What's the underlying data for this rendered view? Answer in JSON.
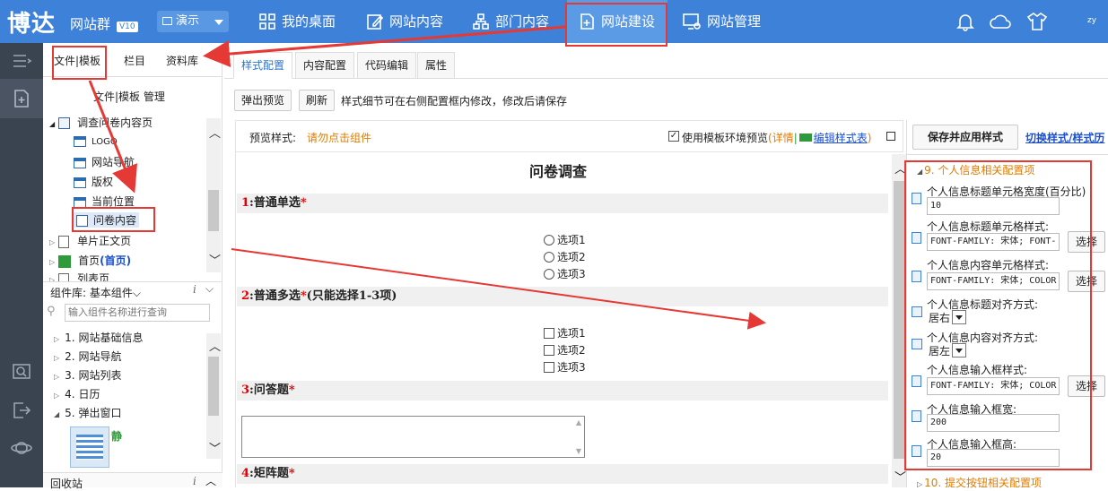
{
  "app": {
    "logo": "博达",
    "logo_sub": "网站群",
    "version": "V10",
    "demo": "演示"
  },
  "nav": [
    {
      "label": "我的桌面"
    },
    {
      "label": "网站内容"
    },
    {
      "label": "部门内容"
    },
    {
      "label": "网站建设"
    },
    {
      "label": "网站管理"
    }
  ],
  "user_short": "zy",
  "left": {
    "tabs": [
      "文件|模板",
      "栏目",
      "资料库"
    ],
    "title": "文件|模板 管理",
    "tree": {
      "root": "调查问卷内容页",
      "children": [
        "LOGO",
        "网站导航",
        "版权",
        "当前位置",
        "问卷内容"
      ],
      "siblings": [
        "单片正文页",
        "首页",
        "(首页)",
        "列表页"
      ]
    },
    "component_lib": "组件库: 基本组件",
    "search_placeholder": "输入组件名称进行查询",
    "components": [
      {
        "num": "1.",
        "label": "网站基础信息"
      },
      {
        "num": "2.",
        "label": "网站导航"
      },
      {
        "num": "3.",
        "label": "网站列表"
      },
      {
        "num": "4.",
        "label": "日历"
      },
      {
        "num": "5.",
        "label": "弹出窗口"
      }
    ],
    "thumb_label": "静",
    "recycle": "回收站"
  },
  "main": {
    "tabs": [
      "样式配置",
      "内容配置",
      "代码编辑",
      "属性"
    ],
    "btn_popup": "弹出预览",
    "btn_refresh": "刷新",
    "hint": "样式细节可在右侧配置框内修改，修改后请保存",
    "preview_label": "预览样式:",
    "preview_tip": "请勿点击组件",
    "use_env": "使用模板环境预览",
    "detail": "(详情",
    "edit_style": "编辑样式表",
    "close_paren": ")",
    "survey_title": "问卷调查",
    "questions": [
      {
        "num": "1",
        "text": ":普通单选",
        "req": "*",
        "extra": ""
      },
      {
        "num": "2",
        "text": ":普通多选",
        "req": "*",
        "extra": "(只能选择1-3项)"
      },
      {
        "num": "3",
        "text": ":问答题",
        "req": "*",
        "extra": ""
      },
      {
        "num": "4",
        "text": ":矩阵题",
        "req": "*",
        "extra": ""
      }
    ],
    "radio_opts": [
      "选项1",
      "选项2",
      "选项3"
    ],
    "check_opts": [
      "选项1",
      "选项2",
      "选项3"
    ]
  },
  "config": {
    "save_btn": "保存并应用样式",
    "switch_link": "切换样式/样式历",
    "section9": "9. 个人信息相关配置项",
    "section10": "10. 提交按钮相关配置项",
    "items": [
      {
        "label": "个人信息标题单元格宽度(百分比)",
        "value": "10"
      },
      {
        "label": "个人信息标题单元格样式:",
        "value": "FONT-FAMILY: 宋体; FONT-",
        "btn": "选择"
      },
      {
        "label": "个人信息内容单元格样式:",
        "value": "FONT-FAMILY: 宋体; COLOR",
        "btn": "选择"
      },
      {
        "label": "个人信息标题对齐方式:",
        "value": "居右"
      },
      {
        "label": "个人信息内容对齐方式:",
        "value": "居左"
      },
      {
        "label": "个人信息输入框样式:",
        "value": "FONT-FAMILY: 宋体; COLOR",
        "btn": "选择"
      },
      {
        "label": "个人信息输入框宽:",
        "value": "200"
      },
      {
        "label": "个人信息输入框高:",
        "value": "20"
      }
    ]
  },
  "colors": {
    "topbar": "#3d82d8",
    "accent": "#2f74c8",
    "annotation": "#e53935",
    "required": "#dd0000"
  }
}
